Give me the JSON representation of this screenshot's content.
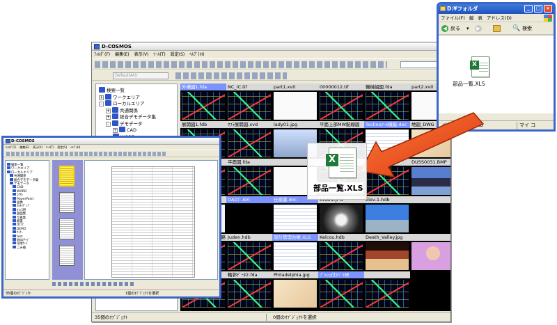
{
  "main_window": {
    "title": "D-COSMOS",
    "menu": [
      "ﾌｫﾙﾀﾞ(F)",
      "編集(E)",
      "表示(V)",
      "ﾂｰﾙ(T)",
      "設定(S)",
      "ﾍﾙﾌﾟ(H)"
    ],
    "attr_select_placeholder": "DefaultAttr",
    "tree": [
      {
        "label": "検索一覧",
        "expander": "",
        "level": 0
      },
      {
        "label": "ワークエリア",
        "expander": "+",
        "level": 0
      },
      {
        "label": "ローカルエリア",
        "expander": "-",
        "level": 0
      },
      {
        "label": "共通関係",
        "expander": "+",
        "level": 1
      },
      {
        "label": "総合デモデータ集",
        "expander": "+",
        "level": 1
      },
      {
        "label": "デモデータ",
        "expander": "-",
        "level": 1
      },
      {
        "label": "CAD",
        "expander": "+",
        "level": 2
      },
      {
        "label": "WORD",
        "expander": "",
        "level": 2
      }
    ],
    "grid": [
      {
        "name": "外構図1.fda",
        "selected": true,
        "thumb": "cad"
      },
      {
        "name": "NC_IC.tif",
        "selected": false,
        "thumb": "cad"
      },
      {
        "name": "part1.xv0",
        "selected": false,
        "thumb": "white"
      },
      {
        "name": "00000012.tif",
        "selected": false,
        "thumb": "cad"
      },
      {
        "name": "機械組図.fda",
        "selected": false,
        "thumb": "cad"
      },
      {
        "name": "part2.xv0",
        "selected": false,
        "thumb": "white"
      },
      {
        "name": "展開図1.fdb",
        "selected": false,
        "thumb": "cad"
      },
      {
        "name": "ﾏﾌﾗ展開図.xvd",
        "selected": false,
        "thumb": "cad"
      },
      {
        "name": "lady01.jpg",
        "selected": false,
        "thumb": "photo"
      },
      {
        "name": "平面上部MW配線図",
        "selected": false,
        "thumb": "cad"
      },
      {
        "name": "Technoﾂｰﾙ機能.doc",
        "selected": true,
        "thumb": "doc"
      },
      {
        "name": "地図_DWG",
        "selected": false,
        "thumb": "map"
      },
      {
        "name": "配管図面.xvd",
        "selected": false,
        "thumb": "cad"
      },
      {
        "name": "平面図.fda",
        "selected": false,
        "thumb": "cad"
      },
      {
        "name": "",
        "selected": false,
        "thumb": "white"
      },
      {
        "name": "",
        "selected": false,
        "thumb": "cad"
      },
      {
        "name": "",
        "selected": false,
        "thumb": "cad"
      },
      {
        "name": "DUSS0031.BMP",
        "selected": false,
        "thumb": "dome"
      },
      {
        "name": "Mwall.JPG",
        "selected": false,
        "thumb": "pink"
      },
      {
        "name": "OAﾛｺﾞ.AVI",
        "selected": true,
        "thumb": "black"
      },
      {
        "name": "仕様書.doc",
        "selected": true,
        "thumb": "doc"
      },
      {
        "name": "XRAY2.JPG",
        "selected": false,
        "thumb": "xray"
      },
      {
        "name": "Elev-1.hdb",
        "selected": false,
        "thumb": "building"
      },
      {
        "name": "",
        "selected": false,
        "thumb": "black"
      },
      {
        "name": "HD-1075-10-04回路",
        "selected": false,
        "thumb": "cad"
      },
      {
        "name": "Juden.hdb",
        "selected": false,
        "thumb": "cad"
      },
      {
        "name": "設計管理台帳.XLS",
        "selected": true,
        "thumb": "doc"
      },
      {
        "name": "Kelcou.hdb",
        "selected": false,
        "thumb": "cad"
      },
      {
        "name": "Death_Valley.jpg",
        "selected": false,
        "thumb": "valley"
      },
      {
        "name": "",
        "selected": false,
        "thumb": "girl"
      },
      {
        "name": "Sample1.hdb",
        "selected": false,
        "thumb": "cad"
      },
      {
        "name": "輪郭ﾃﾞｰﾀ2.fda",
        "selected": false,
        "thumb": "cad"
      },
      {
        "name": "Philadelphia.jpg",
        "selected": false,
        "thumb": "map"
      },
      {
        "name": "ﾌﾟｯｼｭ付ｽﾍﾟﾘ研",
        "selected": true,
        "thumb": "cad"
      },
      {
        "name": "",
        "selected": false,
        "thumb": "cad"
      }
    ],
    "status_left": "35個のｵﾌﾞｼﾞｪｸﾄ",
    "status_right": "0個のｵﾌﾞｼﾞｪｸﾄを選択"
  },
  "preview_window": {
    "title": "D-COSMOS",
    "menu": [
      "ﾌｫﾙﾀﾞ(F)",
      "編集(E)",
      "表示(V)",
      "ﾂｰﾙ(T)",
      "設定(S)",
      "ﾍﾙﾌﾟ(H)"
    ],
    "tree": [
      "検索一覧",
      "ワークエリア",
      "ローカルエリア",
      "共通関係",
      "総合デモデータ集",
      "デモデータ",
      "CAD",
      "WORD",
      "ｴｸｾﾙ",
      "PowerPoint",
      "画像",
      "ﾏﾙﾁﾒﾃﾞｨｱ",
      "ｵﾌｨｽ用",
      "図面集",
      "写真集",
      "蔵書",
      "Dｴﾘｱ",
      "DEMO",
      "ｾﾐﾅｰ",
      "test",
      "Webｻｰﾊﾞ",
      "環境ｻｰﾊﾞ",
      "ごみ箱"
    ],
    "status_left": "35個のｵﾌﾞｼﾞｪｸﾄ",
    "status_right": "1個のｵﾌﾞｼﾞｪｸﾄを選択"
  },
  "explorer_window": {
    "title": "D:¥フォルダ",
    "menu": [
      "ファイル(F)",
      "編",
      "表",
      "アドレス(D)"
    ],
    "back_label": "戻る",
    "search_label": "検索",
    "file_name": "部品一覧.XLS",
    "status_size": "バイト数: 32.0 KB",
    "status_location": "マイ コ"
  },
  "drag": {
    "file_name": "部品一覧.XLS"
  },
  "colors": {
    "selected_label": "#7a93ff",
    "arrow": "#e84a1e",
    "window_border": "#3a67c8",
    "excel_green": "#1f7a3a"
  }
}
